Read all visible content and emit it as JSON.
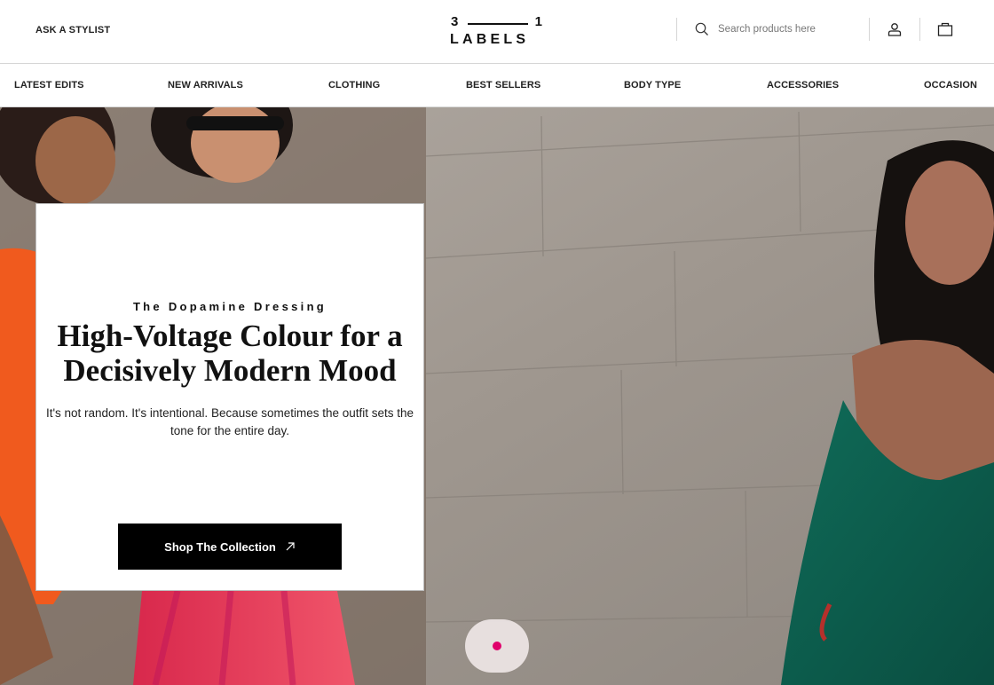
{
  "header": {
    "stylist_link": "ASK A STYLIST",
    "logo": {
      "top_left": "3",
      "top_right": "1",
      "bottom": "LABELS"
    },
    "search_placeholder": "Search products here",
    "icons": [
      "search-icon",
      "user-icon",
      "shopping-bag-icon"
    ]
  },
  "nav": {
    "items": [
      "LATEST EDITS",
      "NEW ARRIVALS",
      "CLOTHING",
      "BEST SELLERS",
      "BODY TYPE",
      "ACCESSORIES",
      "OCCASION"
    ]
  },
  "hero": {
    "eyebrow": "The Dopamine Dressing",
    "headline_line1": "High-Voltage Colour for a",
    "headline_line2": "Decisively Modern Mood",
    "body": "It's not random. It's intentional. Because sometimes the outfit sets the tone for the entire day.",
    "cta_label": "Shop The Collection",
    "carousel": {
      "current": 1,
      "total": 1,
      "active_color": "#e0006b"
    }
  },
  "colors": {
    "accent": "#e0006b",
    "cta_bg": "#000000"
  }
}
